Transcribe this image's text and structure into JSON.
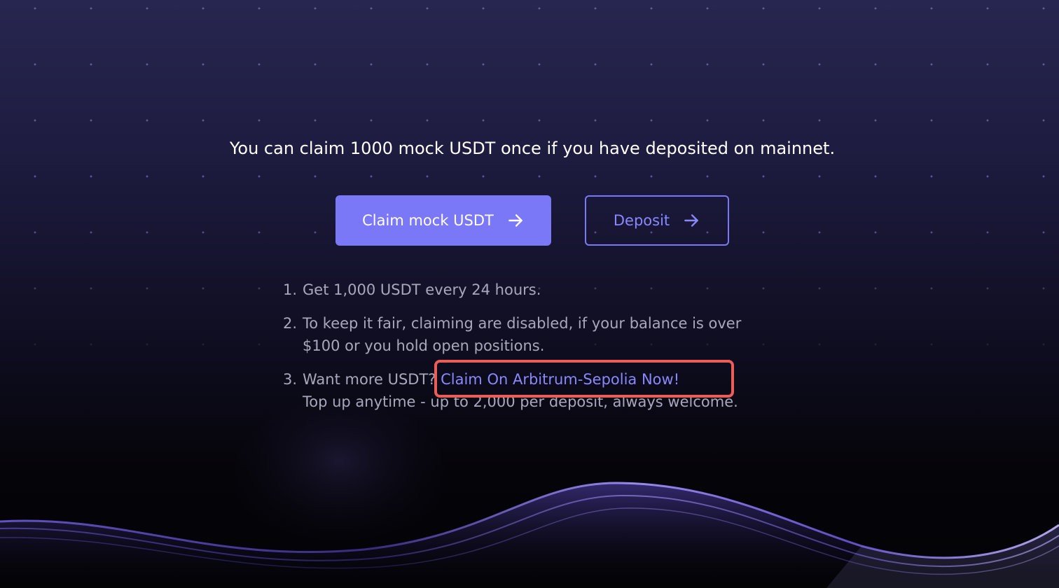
{
  "headline": "You can claim 1000 mock USDT once if you have deposited on mainnet.",
  "buttons": {
    "claim_label": "Claim mock USDT",
    "deposit_label": "Deposit"
  },
  "instructions": [
    {
      "number": "1.",
      "text": "Get 1,000 USDT every 24 hours."
    },
    {
      "number": "2.",
      "line1": "To keep it fair, claiming are disabled, if your balance is over",
      "line2": "$100 or you hold open positions."
    },
    {
      "number": "3.",
      "prefix": "Want more USDT? ",
      "link": "Claim On Arbitrum-Sepolia Now!",
      "line2": "Top up anytime - up to 2,000 per deposit, always welcome."
    }
  ],
  "colors": {
    "accent": "#7b78f8",
    "link": "#8b87ff",
    "highlight": "#ec5d57",
    "muted_text": "#a8a8bd",
    "background_top": "#272650",
    "background_bottom": "#030306"
  },
  "icons": {
    "button_arrow": "arrow-right-icon"
  }
}
